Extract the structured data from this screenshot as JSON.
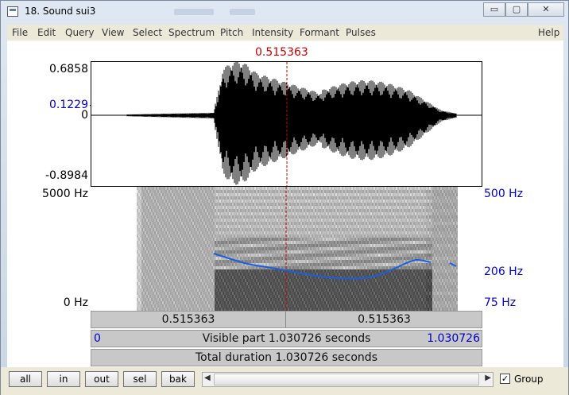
{
  "window": {
    "title": "18. Sound sui3",
    "minimize": "▭",
    "maximize": "▢",
    "close": "✕"
  },
  "menu": [
    "File",
    "Edit",
    "Query",
    "View",
    "Select",
    "Spectrum",
    "Pitch",
    "Intensity",
    "Formant",
    "Pulses"
  ],
  "help": "Help",
  "cursor": {
    "time": "0.515363",
    "color": "#cc0000"
  },
  "waveform": {
    "y_max": "0.6858",
    "y_cursor": "0.1229",
    "y_zero": "0",
    "y_min": "-0.8984"
  },
  "spectrogram": {
    "freq_top": "5000 Hz",
    "freq_bottom": "0 Hz",
    "pitch_top": "500 Hz",
    "pitch_mid": "206 Hz",
    "pitch_bottom": "75 Hz",
    "pitch_color": "#1a5fe0"
  },
  "bars": {
    "left_segment": "0.515363",
    "right_segment": "0.515363",
    "visible_start": "0",
    "visible_label": "Visible part 1.030726 seconds",
    "visible_end": "1.030726",
    "total_label": "Total duration 1.030726 seconds"
  },
  "buttons": {
    "all": "all",
    "in": "in",
    "out": "out",
    "sel": "sel",
    "bak": "bak"
  },
  "group": {
    "label": "Group",
    "checked": "✓"
  }
}
